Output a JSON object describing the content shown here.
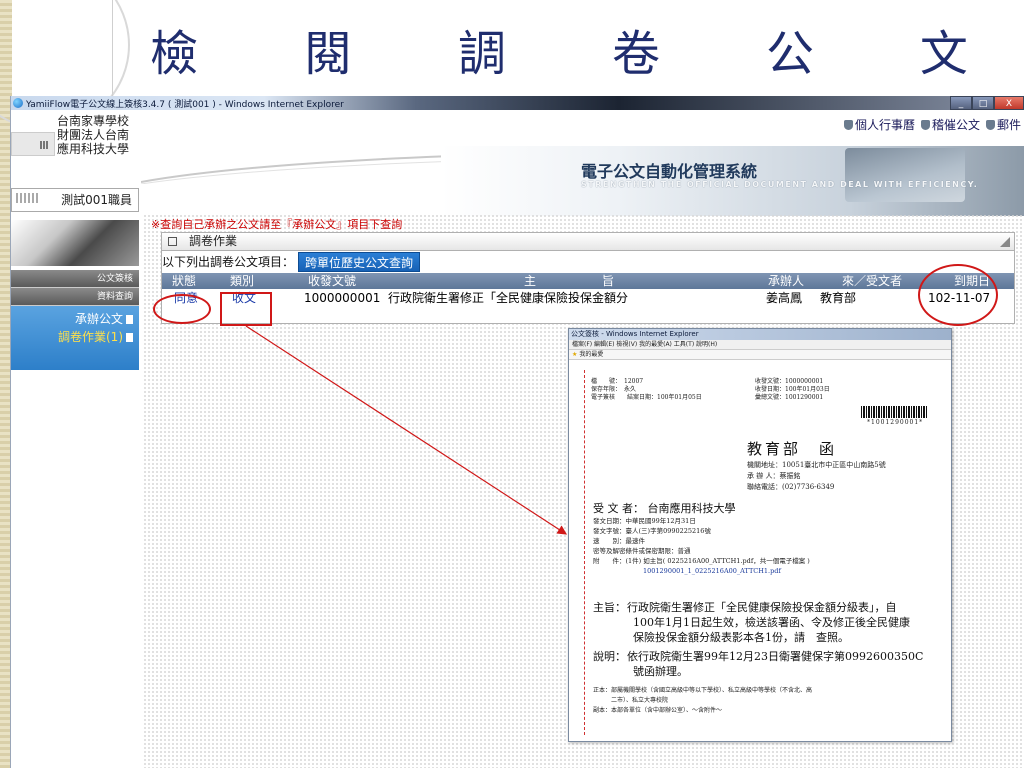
{
  "slide": {
    "title_chars": [
      "檢",
      "閱",
      "調",
      "卷",
      "公",
      "文"
    ]
  },
  "window": {
    "title": "YamiiFlow電子公文線上簽核3.4.7 ( 測試001 ) - Windows Internet Explorer",
    "btn_min": "_",
    "btn_max": "□",
    "btn_close": "X"
  },
  "header": {
    "school_lines": [
      "台南家專學校",
      "財團法人台南",
      "應用科技大學"
    ],
    "links": [
      "個人行事曆",
      "稽催公文",
      "郵件"
    ],
    "banner_title": "電子公文自動化管理系統",
    "banner_sub": "STRENGTHEN THE OFFICIAL DOCUMENT AND DEAL WITH EFFICIENCY."
  },
  "sidebar": {
    "user": "測試001職員",
    "menu_heads": [
      "公文簽核",
      "資料查詢"
    ],
    "items": [
      {
        "label": "承辦公文"
      },
      {
        "label": "調卷作業(1)"
      }
    ]
  },
  "main": {
    "notice": "※查詢自己承辦之公文請至『承辦公文』項目下查詢",
    "panel_title": "調卷作業",
    "list_label": "以下列出調卷公文項目：",
    "history_button": "跨單位歷史公文查詢",
    "columns": {
      "status": "狀態",
      "category": "類別",
      "doc_no": "收發文號",
      "subject_a": "主",
      "subject_b": "旨",
      "handler": "承辦人",
      "from_to": "來／受文者",
      "due": "到期日"
    },
    "rows": [
      {
        "status": "同意",
        "category": "收文",
        "doc_no": "1000000001",
        "subject": "行政院衛生署修正「全民健康保險投保金額分",
        "handler": "姜高鳳",
        "from_to": "教育部",
        "due": "102-11-07"
      }
    ]
  },
  "popup": {
    "title": "公文簽核 - Windows Internet Explorer",
    "menu": "檔案(F)  編輯(E)  檢視(V)  我的最愛(A)  工具(T)  說明(H)",
    "favorites": "我的最愛",
    "meta_left": [
      "檔　　號：　12007",
      "保存年限：　永久",
      "電子簽核　　結案日期：100年01月05日"
    ],
    "meta_right": [
      "收發文號：1000000001",
      "收發日期：100年01月03日",
      "彙總文號：1001290001"
    ],
    "barcode_text": "*1001290001*",
    "org_title": "教育部　函",
    "org_info": [
      "機關地址：10051臺北市中正區中山南路5號",
      "承 辦 人：蔡振銘",
      "聯絡電話：(02)7736-6349"
    ],
    "recipient": "受 文 者： 台南應用科技大學",
    "details": [
      "發文日期：中華民國99年12月31日",
      "發文字號：臺人(三)字第0990225216號",
      "速　　別：最速件",
      "密等及解密條件或保密期限：普通"
    ],
    "attach_label": "附　　件：(1件) 如主旨( 0225216A00_ATTCH1.pdf，共一個電子檔案 )",
    "attach_file": "1001290001_1_0225216A00_ATTCH1.pdf",
    "subject_label": "主旨：",
    "subject_lines": [
      "行政院衛生署修正「全民健康保險投保金額分級表」，自",
      "100年1月1日起生效，檢送該署函、令及修正後全民健康",
      "保險投保金額分級表影本各1份，請　查照。"
    ],
    "explain_label": "說明：",
    "explain_lines": [
      "依行政院衛生署99年12月23日衛署健保字第0992600350C",
      "號函辦理。"
    ],
    "cc_lines": [
      "正本：部屬機關學校（含國立高級中等以下學校）、私立高級中等學校（不含北、高",
      "　　　二市）、私立大專校院",
      "副本：本部各單位（含中部辦公室）、～含附件～"
    ]
  }
}
